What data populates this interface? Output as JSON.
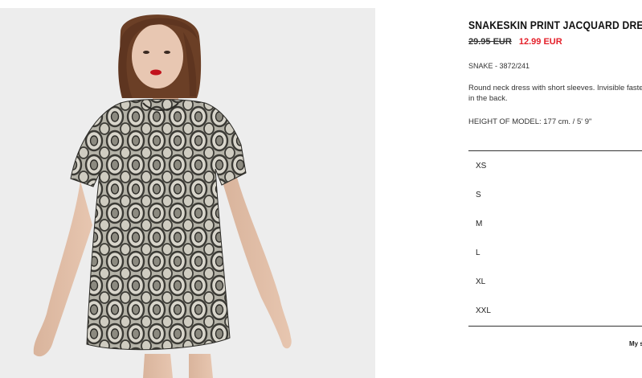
{
  "product": {
    "title": "SNAKESKIN PRINT JACQUARD DRESS",
    "price_original": "29.95 EUR",
    "price_sale": "12.99 EUR",
    "reference": "SNAKE - 3872/241",
    "description": "Round neck dress with short sleeves. Invisible fastening in the back.",
    "model_height": "HEIGHT OF MODEL: 177 cm. / 5' 9\""
  },
  "sizes": [
    "XS",
    "S",
    "M",
    "L",
    "XL",
    "XXL"
  ],
  "size_guide_label": "My size",
  "colors": {
    "sale_price": "#e4202a",
    "photo_background": "#ededed"
  }
}
